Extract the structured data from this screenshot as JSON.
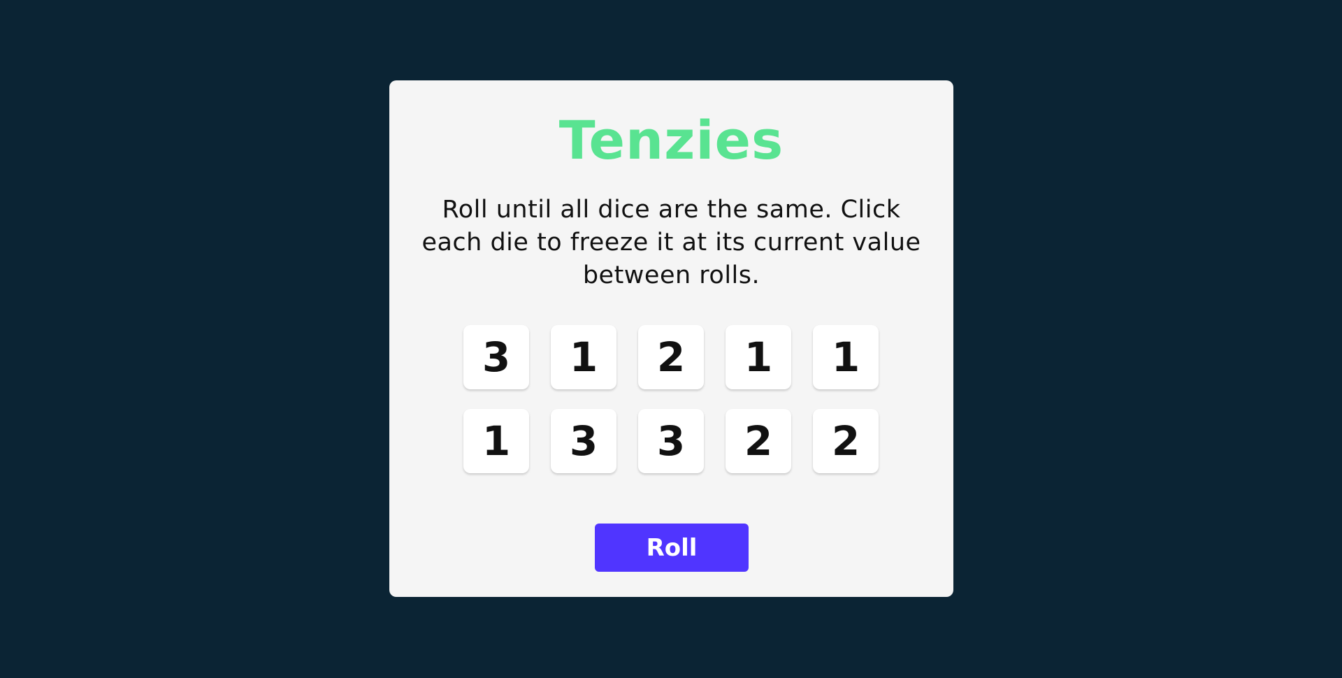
{
  "title": "Tenzies",
  "instructions": "Roll until all dice are the same. Click each die to freeze it at its current value between rolls.",
  "dice": [
    "3",
    "1",
    "2",
    "1",
    "1",
    "1",
    "3",
    "3",
    "2",
    "2"
  ],
  "roll_button_label": "Roll",
  "colors": {
    "background": "#0b2434",
    "panel": "#f5f5f5",
    "title": "#59e391",
    "button": "#5035ff"
  }
}
